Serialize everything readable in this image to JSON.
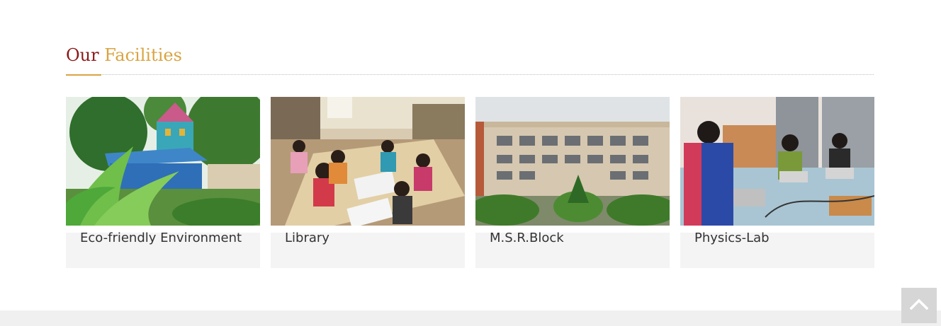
{
  "section": {
    "title_part1": "Our",
    "title_part2": "Facilities",
    "title_color1": "#8b1a1a",
    "title_color2": "#d9a441"
  },
  "facilities": [
    {
      "label": "Eco-friendly Environment",
      "image": "eco-friendly-environment-photo"
    },
    {
      "label": "Library",
      "image": "library-photo"
    },
    {
      "label": "M.S.R.Block",
      "image": "msr-block-photo"
    },
    {
      "label": "Physics-Lab",
      "image": "physics-lab-photo"
    }
  ],
  "back_to_top": {
    "icon": "chevron-up-icon"
  }
}
